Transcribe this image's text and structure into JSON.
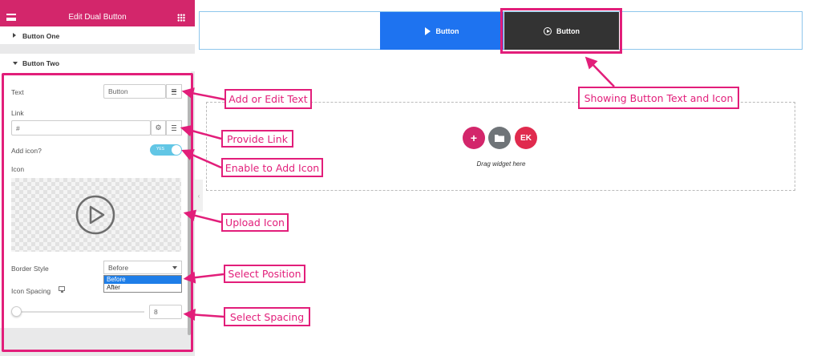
{
  "sidebar": {
    "title": "Edit Dual Button",
    "section_one": "Button One",
    "section_two": "Button Two",
    "fields": {
      "text_label": "Text",
      "text_value": "Button",
      "link_label": "Link",
      "link_value": "#",
      "add_icon_label": "Add icon?",
      "add_icon_toggle": "YES",
      "icon_label": "Icon",
      "border_style_label": "Border Style",
      "border_style_value": "Before",
      "border_style_options": [
        "Before",
        "After"
      ],
      "icon_spacing_label": "Icon Spacing",
      "icon_spacing_value": "8"
    }
  },
  "canvas": {
    "button_one_label": "Button",
    "button_two_label": "Button",
    "drop_text": "Drag widget here"
  },
  "callouts": {
    "add_edit_text": "Add or Edit Text",
    "provide_link": "Provide Link",
    "enable_icon": "Enable to Add Icon",
    "upload_icon": "Upload Icon",
    "select_position": "Select Position",
    "select_spacing": "Select Spacing",
    "showing": "Showing Button Text and Icon"
  },
  "colors": {
    "brand": "#d3266b",
    "annotation": "#e21e7a",
    "button_one_bg": "#1e73f0",
    "button_two_bg": "#333333",
    "toggle": "#62c6e5"
  }
}
